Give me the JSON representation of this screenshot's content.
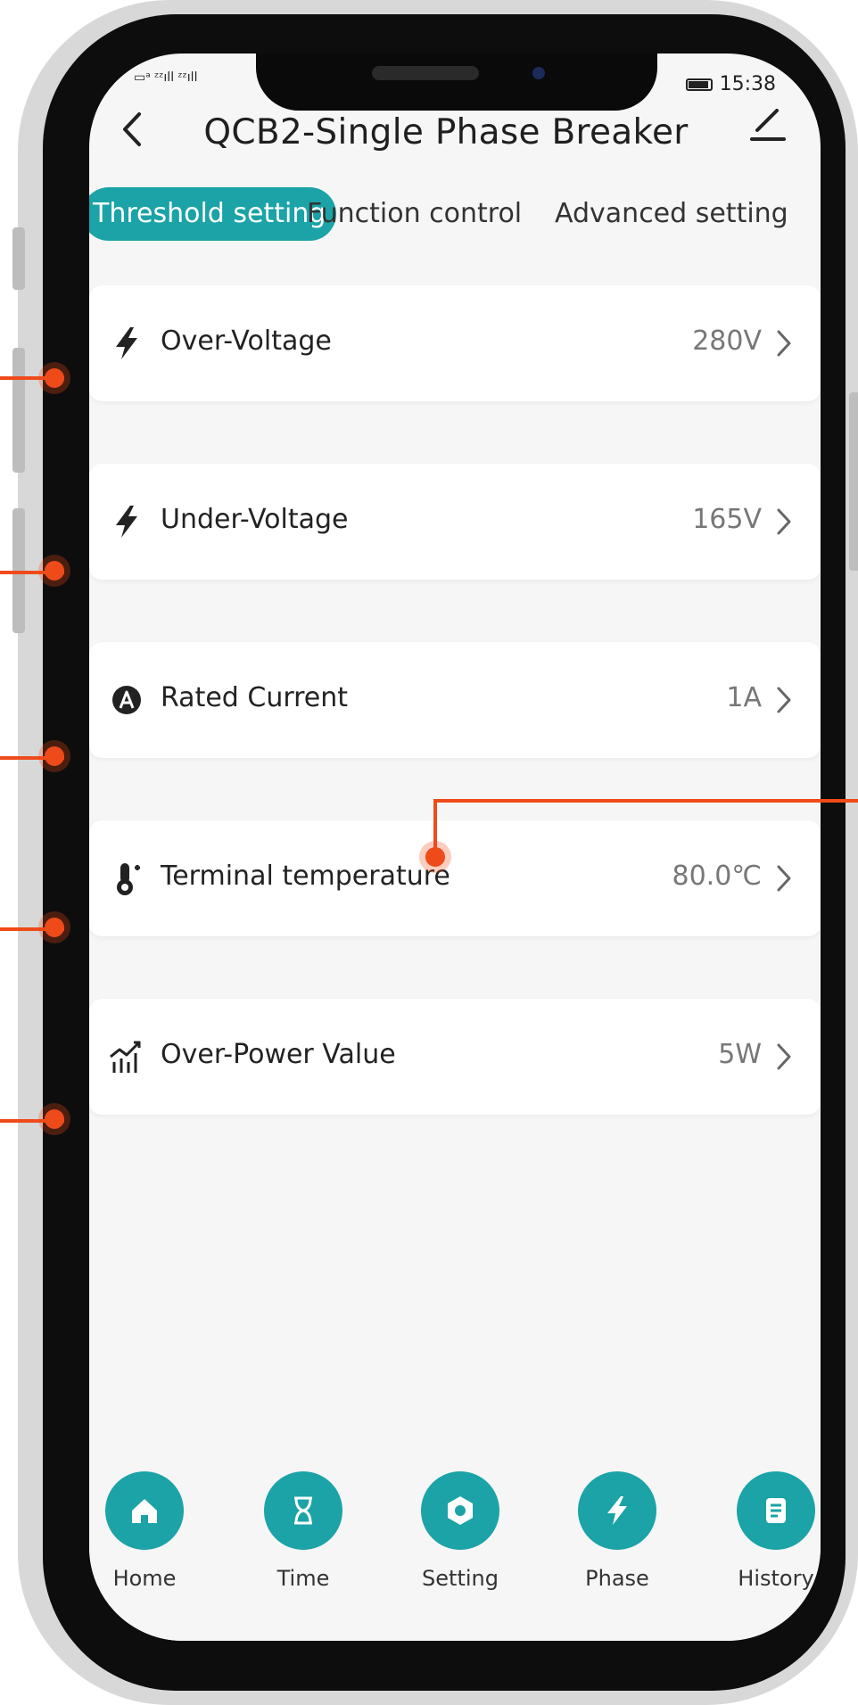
{
  "status_bar": {
    "left_text": "▭ᵃ ᶻᶻıll ᶻᶻıll",
    "time": "15:38"
  },
  "header": {
    "title": "QCB2-Single Phase Breaker"
  },
  "tabs": [
    {
      "label": "Threshold setting",
      "active": true
    },
    {
      "label": "Function control",
      "active": false
    },
    {
      "label": "Advanced setting",
      "active": false
    }
  ],
  "settings": [
    {
      "label": "Over-Voltage",
      "value": "280V",
      "icon": "bolt-icon"
    },
    {
      "label": "Under-Voltage",
      "value": "165V",
      "icon": "bolt-icon"
    },
    {
      "label": "Rated Current",
      "value": "1A",
      "icon": "amp-circle-icon"
    },
    {
      "label": "Terminal temperature",
      "value": "80.0℃",
      "icon": "thermometer-icon"
    },
    {
      "label": "Over-Power Value",
      "value": "5W",
      "icon": "chart-icon"
    }
  ],
  "nav": [
    {
      "label": "Home",
      "icon": "home-icon"
    },
    {
      "label": "Time",
      "icon": "hourglass-icon"
    },
    {
      "label": "Setting",
      "icon": "gear-icon"
    },
    {
      "label": "Phase",
      "icon": "bolt-icon"
    },
    {
      "label": "History",
      "icon": "document-icon"
    }
  ],
  "colors": {
    "accent": "#1ba3a7",
    "callout": "#ef4a1a"
  }
}
